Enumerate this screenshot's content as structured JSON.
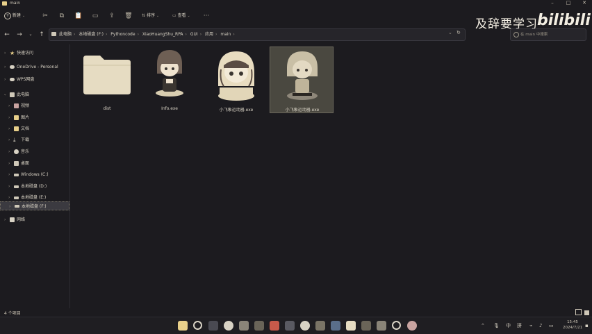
{
  "window": {
    "title": "main"
  },
  "toolbar": {
    "new_label": "新建",
    "sort_label": "排序",
    "view_label": "查看"
  },
  "watermark": {
    "text": "及辞要学习",
    "logo": "bilibili"
  },
  "address": {
    "crumbs": [
      "此电脑",
      "本地磁盘 (F:)",
      "Pythoncode",
      "XiaoHuangShu_RPA",
      "GUI",
      "应用",
      "main"
    ]
  },
  "search": {
    "placeholder": "在 main 中搜索"
  },
  "sidebar": {
    "items": [
      {
        "label": "快速访问",
        "icon": "star-icon",
        "color": "#e8cf8a"
      },
      {
        "label": "OneDrive - Personal",
        "icon": "cloud-icon",
        "color": "#d8d2c4"
      },
      {
        "label": "WPS网盘",
        "icon": "cloud-icon",
        "color": "#d8d2c4"
      },
      {
        "label": "此电脑",
        "icon": "computer-icon",
        "color": "#d8d2c4"
      },
      {
        "label": "视频",
        "icon": "video-icon",
        "color": "#c8a3a0"
      },
      {
        "label": "图片",
        "icon": "picture-icon",
        "color": "#e8cf8a"
      },
      {
        "label": "文档",
        "icon": "document-icon",
        "color": "#e8cf8a"
      },
      {
        "label": "下载",
        "icon": "download-icon",
        "color": "#d8d2c4"
      },
      {
        "label": "音乐",
        "icon": "music-icon",
        "color": "#d8d2c4"
      },
      {
        "label": "桌面",
        "icon": "desktop-icon",
        "color": "#d8d2c4"
      },
      {
        "label": "Windows (C:)",
        "icon": "drive-icon",
        "color": "#d8d2c4"
      },
      {
        "label": "本地磁盘 (D:)",
        "icon": "drive-icon",
        "color": "#d8d2c4"
      },
      {
        "label": "本地磁盘 (E:)",
        "icon": "drive-icon",
        "color": "#d8d2c4"
      },
      {
        "label": "本地磁盘 (F:)",
        "icon": "drive-icon",
        "color": "#d8d2c4"
      },
      {
        "label": "网络",
        "icon": "network-icon",
        "color": "#d8d2c4"
      }
    ]
  },
  "files": [
    {
      "name": "dist",
      "kind": "folder"
    },
    {
      "name": "Info.exe",
      "kind": "exe"
    },
    {
      "name": "小飞象运动器.exe",
      "kind": "exe"
    },
    {
      "name": "小飞象运动器.exe",
      "kind": "exe"
    }
  ],
  "status": {
    "count": "4 个项目"
  },
  "tray": {
    "lang": "中",
    "ime": "拼",
    "time": "15:45",
    "date": "2024/7/21"
  }
}
